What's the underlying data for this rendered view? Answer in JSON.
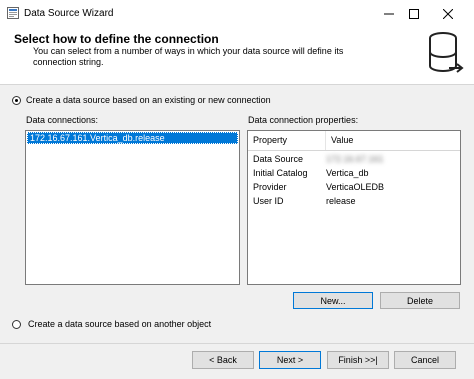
{
  "window": {
    "title": "Data Source Wizard"
  },
  "header": {
    "title": "Select how to define the connection",
    "description": "You can select from a number of ways in which your data source will define its connection string."
  },
  "option_existing": {
    "label": "Create a data source based on an existing or new connection",
    "checked": true
  },
  "connections": {
    "label": "Data connections:",
    "items": [
      "172.16.67.161.Vertica_db.release"
    ]
  },
  "properties": {
    "label": "Data connection properties:",
    "columns": [
      "Property",
      "Value"
    ],
    "rows": [
      {
        "property": "Data Source",
        "value": "172.16.67.161"
      },
      {
        "property": "Initial Catalog",
        "value": "Vertica_db"
      },
      {
        "property": "Provider",
        "value": "VerticaOLEDB"
      },
      {
        "property": "User ID",
        "value": "release"
      }
    ]
  },
  "buttons": {
    "new": "New...",
    "delete": "Delete",
    "back": "< Back",
    "next": "Next >",
    "finish": "Finish >>|",
    "cancel": "Cancel"
  },
  "option_other": {
    "label": "Create a data source based on another object",
    "checked": false
  }
}
